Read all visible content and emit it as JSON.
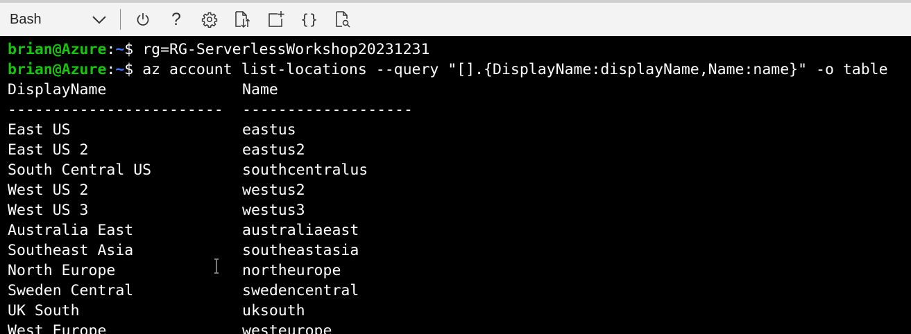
{
  "toolbar": {
    "shell": "Bash",
    "help_glyph": "?",
    "braces_glyph": "{}",
    "icons": [
      "chevron-down-icon",
      "power-icon",
      "help-icon",
      "gear-icon",
      "upload-download-icon",
      "new-session-icon",
      "braces-icon",
      "web-preview-icon"
    ]
  },
  "terminal": {
    "prompt_user": "brian@Azure",
    "prompt_sep": ":",
    "prompt_dir": "~",
    "prompt_sym": "$",
    "commands": [
      "rg=RG-ServerlessWorkshop20231231",
      "az account list-locations --query \"[].{DisplayName:displayName,Name:name}\" -o table"
    ],
    "table": {
      "headers": [
        "DisplayName",
        "Name"
      ],
      "separators": [
        "------------------------",
        "-------------------"
      ],
      "rows": [
        [
          "East US",
          "eastus"
        ],
        [
          "East US 2",
          "eastus2"
        ],
        [
          "South Central US",
          "southcentralus"
        ],
        [
          "West US 2",
          "westus2"
        ],
        [
          "West US 3",
          "westus3"
        ],
        [
          "Australia East",
          "australiaeast"
        ],
        [
          "Southeast Asia",
          "southeastasia"
        ],
        [
          "North Europe",
          "northeurope"
        ],
        [
          "Sweden Central",
          "swedencentral"
        ],
        [
          "UK South",
          "uksouth"
        ],
        [
          "West Europe",
          "westeurope"
        ]
      ]
    }
  },
  "colors": {
    "terminal_bg": "#000000",
    "prompt_user": "#16c60c",
    "prompt_dir": "#3b78ff",
    "text": "#ffffff",
    "toolbar_bg": "#f3f3f3"
  }
}
